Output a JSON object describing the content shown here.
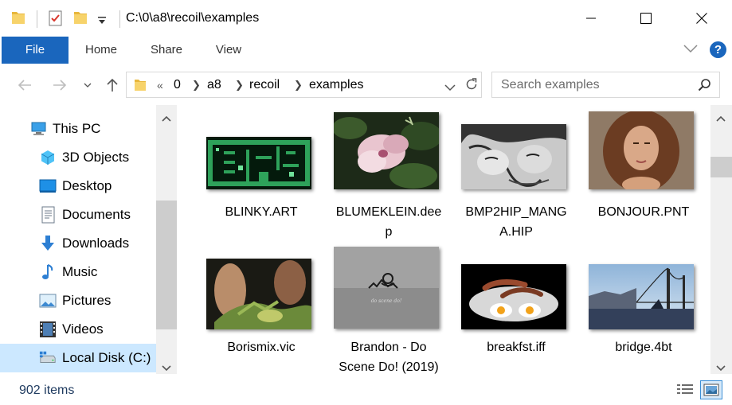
{
  "window": {
    "title": "C:\\0\\a8\\recoil\\examples"
  },
  "ribbon": {
    "tabs": [
      "File",
      "Home",
      "Share",
      "View"
    ],
    "help_label": "?"
  },
  "address": {
    "overflow": "«",
    "crumbs": [
      "0",
      "a8",
      "recoil",
      "examples"
    ]
  },
  "search": {
    "placeholder": "Search examples"
  },
  "sidebar": {
    "items": [
      {
        "label": "This PC",
        "icon": "computer-icon"
      },
      {
        "label": "3D Objects",
        "icon": "cube-icon"
      },
      {
        "label": "Desktop",
        "icon": "desktop-icon"
      },
      {
        "label": "Documents",
        "icon": "documents-icon"
      },
      {
        "label": "Downloads",
        "icon": "download-arrow-icon"
      },
      {
        "label": "Music",
        "icon": "music-note-icon"
      },
      {
        "label": "Pictures",
        "icon": "pictures-icon"
      },
      {
        "label": "Videos",
        "icon": "film-icon"
      },
      {
        "label": "Local Disk (C:)",
        "icon": "drive-icon",
        "selected": true
      }
    ]
  },
  "files": [
    {
      "name": "BLINKY.ART",
      "line1": "BLINKY.ART",
      "line2": ""
    },
    {
      "name": "BLUMEKLEIN.deep",
      "line1": "BLUMEKLEIN.dee",
      "line2": "p"
    },
    {
      "name": "BMP2HIP_MANGA.HIP",
      "line1": "BMP2HIP_MANG",
      "line2": "A.HIP"
    },
    {
      "name": "BONJOUR.PNT",
      "line1": "BONJOUR.PNT",
      "line2": ""
    },
    {
      "name": "Borismix.vic",
      "line1": "Borismix.vic",
      "line2": ""
    },
    {
      "name": "Brandon - Do Scene Do! (2019)",
      "line1": "Brandon - Do",
      "line2": "Scene Do! (2019)"
    },
    {
      "name": "breakfst.iff",
      "line1": "breakfst.iff",
      "line2": ""
    },
    {
      "name": "bridge.4bt",
      "line1": "bridge.4bt",
      "line2": ""
    }
  ],
  "thumbnail_caption": "do scene do!",
  "status": {
    "item_count": "902 items"
  },
  "colors": {
    "accent": "#1a66bd",
    "selection": "#cce8ff"
  }
}
